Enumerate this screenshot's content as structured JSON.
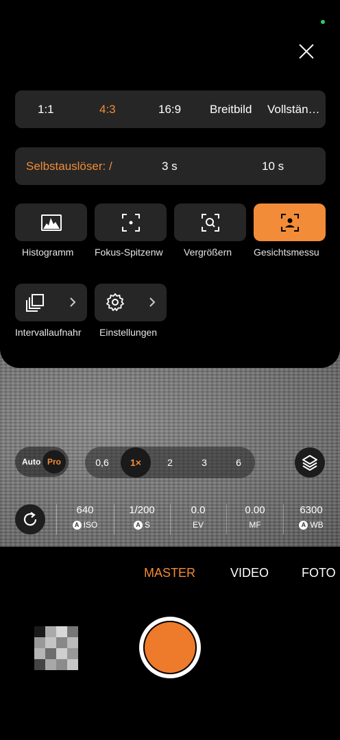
{
  "aspect_ratios": {
    "options": [
      "1:1",
      "4:3",
      "16:9",
      "Breitbild",
      "Vollstän…"
    ],
    "selected": "4:3"
  },
  "self_timer": {
    "label": "Selbstauslöser: /",
    "options": [
      "3 s",
      "10 s"
    ]
  },
  "tools": [
    {
      "label": "Histogramm",
      "icon": "histogram-icon",
      "active": false
    },
    {
      "label": "Fokus-Spitzenw",
      "icon": "focus-peaking-icon",
      "active": false
    },
    {
      "label": "Vergrößern",
      "icon": "magnify-icon",
      "active": false
    },
    {
      "label": "Gesichtsmessu",
      "icon": "face-metering-icon",
      "active": true
    }
  ],
  "more_tools": [
    {
      "label": "Intervallaufnahr",
      "icon": "interval-icon"
    },
    {
      "label": "Einstellungen",
      "icon": "gear-icon"
    }
  ],
  "capture_mode": {
    "auto": "Auto",
    "pro": "Pro"
  },
  "zoom": {
    "options": [
      "0,6",
      "1×",
      "2",
      "3",
      "6"
    ],
    "selected": "1×"
  },
  "params": [
    {
      "value": "640",
      "label": "ISO",
      "auto": true
    },
    {
      "value": "1/200",
      "label": "S",
      "auto": true
    },
    {
      "value": "0.0",
      "label": "EV",
      "auto": false
    },
    {
      "value": "0.00",
      "label": "MF",
      "auto": false
    },
    {
      "value": "6300",
      "label": "WB",
      "auto": true
    }
  ],
  "modes": {
    "items": [
      "MASTER",
      "VIDEO",
      "FOTO"
    ],
    "selected": "MASTER"
  },
  "colors": {
    "accent": "#f28c38",
    "panel": "#262626",
    "background": "#000000"
  }
}
